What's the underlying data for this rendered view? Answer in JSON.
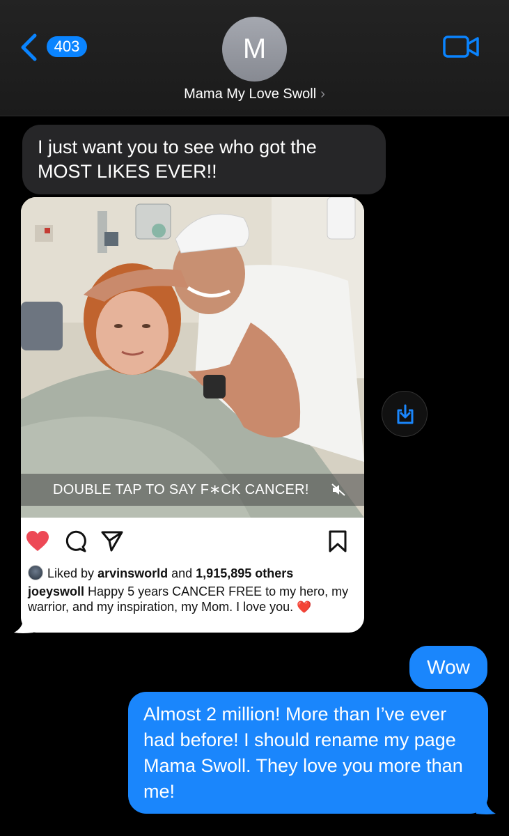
{
  "header": {
    "back_badge": "403",
    "avatar_initial": "M",
    "contact_name": "Mama My Love Swoll",
    "chevron": "›"
  },
  "icons": {
    "back": "chevron-left-icon",
    "facetime": "video-camera-icon",
    "save": "download-icon",
    "mute": "speaker-muted-icon",
    "like": "heart-icon",
    "comment": "comment-icon",
    "share": "paper-plane-icon",
    "bookmark": "bookmark-icon"
  },
  "colors": {
    "imessage_blue": "#1a86fc",
    "received_bubble": "#262628",
    "like_red": "#ed4956",
    "badge_blue": "#0a84ff"
  },
  "messages": {
    "received_1": "I just want you to see who got the MOST LIKES EVER!!",
    "sent_1": "Wow",
    "sent_2": "Almost 2 million! More than I’ve ever had before! I should rename my page Mama Swoll. They love you more than me!"
  },
  "post": {
    "overlay_text": "DOUBLE TAP TO SAY F∗CK CANCER!",
    "liked_by_prefix": "Liked by",
    "liked_by_user": "arvinsworld",
    "liked_by_and": "and",
    "liked_by_count": "1,915,895 others",
    "caption_user": "joeyswoll",
    "caption_text": "Happy 5 years CANCER FREE to my hero, my warrior, and my inspiration, my Mom. I love you.",
    "caption_emoji": "❤️"
  }
}
